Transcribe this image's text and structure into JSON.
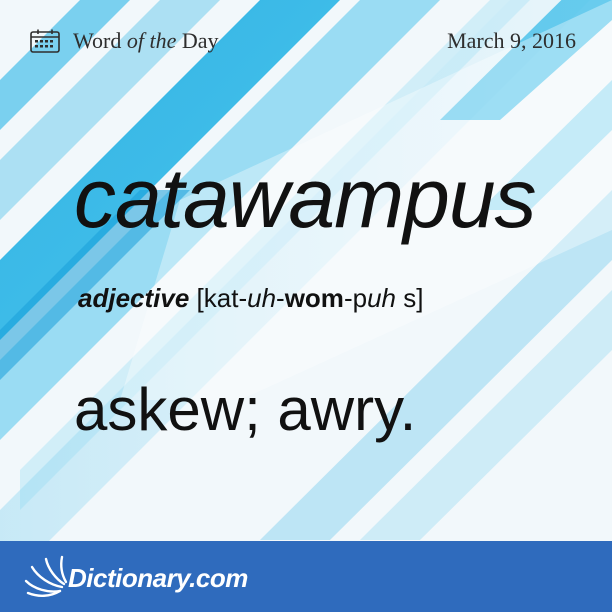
{
  "header": {
    "title_prefix": "Word",
    "title_middle": "of the",
    "title_suffix": "Day",
    "date": "March 9, 2016"
  },
  "entry": {
    "word": "catawampus",
    "part_of_speech": "adjective",
    "pronunciation": {
      "open": "[",
      "p1": "kat-",
      "p2": "uh",
      "p3": "-",
      "p4": "wom",
      "p5": "-p",
      "p6": "uh",
      "p7": " s",
      "close": "]"
    },
    "definition": "askew; awry."
  },
  "footer": {
    "brand": "Dictionary.com"
  },
  "colors": {
    "accent_blue": "#2f6bbd",
    "stripe_cyan": "#1fb3e6",
    "stripe_light": "#8fd6f0",
    "text_dark": "#111111"
  },
  "icons": [
    "calendar-icon",
    "dictionary-logo-icon"
  ]
}
